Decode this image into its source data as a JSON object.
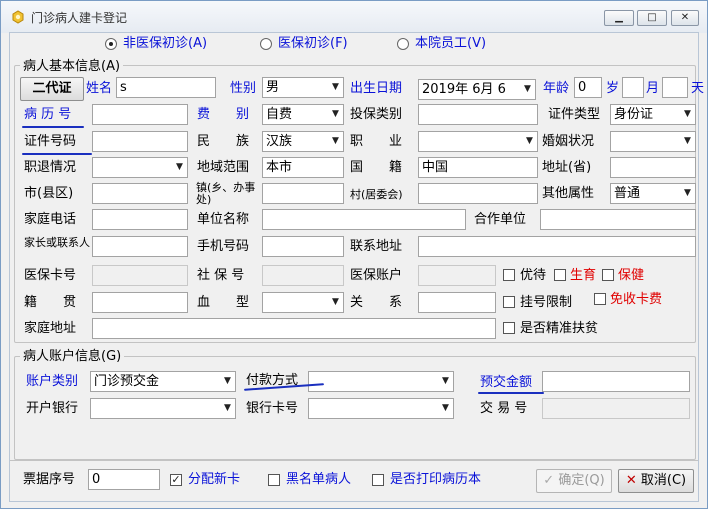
{
  "window": {
    "title": "门诊病人建卡登记",
    "min": "▁",
    "max": "□",
    "close": "✕"
  },
  "mode": {
    "options": [
      "非医保初诊(A)",
      "医保初诊(F)",
      "本院员工(V)"
    ],
    "selected_index": 0
  },
  "patient": {
    "group_title": "病人基本信息(A)",
    "id_card_button": "二代证",
    "name_label": "姓名",
    "name_value": "s",
    "gender_label": "性别",
    "gender_value": "男",
    "dob_label": "出生日期",
    "dob_value": "2019年 6月 6",
    "age_label": "年龄",
    "age_value": "0",
    "age_unit_year": "岁",
    "age_unit_month": "月",
    "age_unit_day": "天",
    "record_no_label": "病 历 号",
    "record_no_value": "",
    "fee_label": "费　　别",
    "fee_value": "自费",
    "insure_type_label": "投保类别",
    "insure_type_value": "",
    "cert_type_label": "证件类型",
    "cert_type_value": "身份证",
    "cert_no_label": "证件号码",
    "cert_no_value": "",
    "nation_label": "民　　族",
    "nation_value": "汉族",
    "job_label": "职　　业",
    "job_value": "",
    "marital_label": "婚姻状况",
    "marital_value": "",
    "job_status_label": "职退情况",
    "job_status_value": "",
    "region_label": "地域范围",
    "region_value": "本市",
    "nationality_label": "国　　籍",
    "nationality_value": "中国",
    "province_label": "地址(省)",
    "province_value": "",
    "city_label": "市(县区)",
    "city_value": "",
    "town_label": "镇(乡、办事处)",
    "town_value": "",
    "village_label": "村(居委会)",
    "village_value": "",
    "other_attr_label": "其他属性",
    "other_attr_value": "普通",
    "home_phone_label": "家庭电话",
    "home_phone_value": "",
    "employer_label": "单位名称",
    "employer_value": "",
    "coop_label": "合作单位",
    "coop_value": "",
    "guardian_label": "家长或联系人",
    "guardian_value": "",
    "mobile_label": "手机号码",
    "mobile_value": "",
    "contact_addr_label": "联系地址",
    "contact_addr_value": "",
    "med_card_label": "医保卡号",
    "med_card_value": "",
    "social_no_label": "社 保 号",
    "social_no_value": "",
    "med_account_label": "医保账户",
    "med_account_value": "",
    "priority_label": "优待",
    "birth_label": "生育",
    "health_label": "保健",
    "native_label": "籍　　贯",
    "native_value": "",
    "blood_label": "血　　型",
    "blood_value": "",
    "relation_label": "关　　系",
    "relation_value": "",
    "limit_label": "挂号限制",
    "free_fee_label": "免收卡费",
    "home_addr_label": "家庭地址",
    "home_addr_value": "",
    "poverty_label": "是否精准扶贫"
  },
  "account": {
    "group_title": "病人账户信息(G)",
    "type_label": "账户类别",
    "type_value": "门诊预交金",
    "pay_label": "付款方式",
    "pay_value": "",
    "prepay_label": "预交金额",
    "prepay_value": "",
    "bank_label": "开户银行",
    "bank_value": "",
    "bank_card_label": "银行卡号",
    "bank_card_value": "",
    "trade_no_label": "交 易 号",
    "trade_no_value": ""
  },
  "footer": {
    "receipt_label": "票据序号",
    "receipt_value": "0",
    "assign_card_label": "分配新卡",
    "assign_card_checked": true,
    "blacklist_label": "黑名单病人",
    "blacklist_checked": false,
    "print_label": "是否打印病历本",
    "print_checked": false,
    "ok_label": "确定(Q)",
    "cancel_label": "取消(C)"
  },
  "colors": {
    "label_blue": "#0a12d8",
    "label_red": "#e00000",
    "annotation_underline": "#1a2fbf"
  }
}
